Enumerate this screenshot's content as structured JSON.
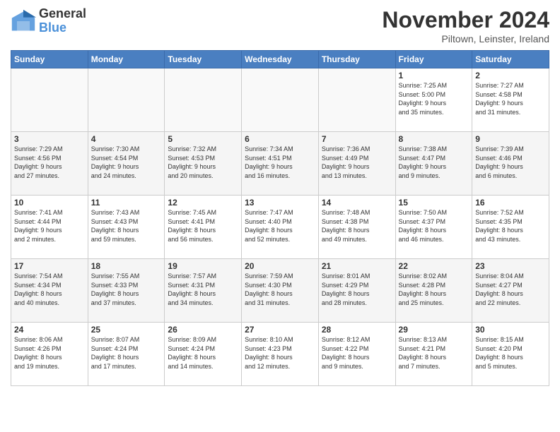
{
  "logo": {
    "general": "General",
    "blue": "Blue"
  },
  "title": "November 2024",
  "location": "Piltown, Leinster, Ireland",
  "days_of_week": [
    "Sunday",
    "Monday",
    "Tuesday",
    "Wednesday",
    "Thursday",
    "Friday",
    "Saturday"
  ],
  "weeks": [
    [
      {
        "day": "",
        "info": ""
      },
      {
        "day": "",
        "info": ""
      },
      {
        "day": "",
        "info": ""
      },
      {
        "day": "",
        "info": ""
      },
      {
        "day": "",
        "info": ""
      },
      {
        "day": "1",
        "info": "Sunrise: 7:25 AM\nSunset: 5:00 PM\nDaylight: 9 hours\nand 35 minutes."
      },
      {
        "day": "2",
        "info": "Sunrise: 7:27 AM\nSunset: 4:58 PM\nDaylight: 9 hours\nand 31 minutes."
      }
    ],
    [
      {
        "day": "3",
        "info": "Sunrise: 7:29 AM\nSunset: 4:56 PM\nDaylight: 9 hours\nand 27 minutes."
      },
      {
        "day": "4",
        "info": "Sunrise: 7:30 AM\nSunset: 4:54 PM\nDaylight: 9 hours\nand 24 minutes."
      },
      {
        "day": "5",
        "info": "Sunrise: 7:32 AM\nSunset: 4:53 PM\nDaylight: 9 hours\nand 20 minutes."
      },
      {
        "day": "6",
        "info": "Sunrise: 7:34 AM\nSunset: 4:51 PM\nDaylight: 9 hours\nand 16 minutes."
      },
      {
        "day": "7",
        "info": "Sunrise: 7:36 AM\nSunset: 4:49 PM\nDaylight: 9 hours\nand 13 minutes."
      },
      {
        "day": "8",
        "info": "Sunrise: 7:38 AM\nSunset: 4:47 PM\nDaylight: 9 hours\nand 9 minutes."
      },
      {
        "day": "9",
        "info": "Sunrise: 7:39 AM\nSunset: 4:46 PM\nDaylight: 9 hours\nand 6 minutes."
      }
    ],
    [
      {
        "day": "10",
        "info": "Sunrise: 7:41 AM\nSunset: 4:44 PM\nDaylight: 9 hours\nand 2 minutes."
      },
      {
        "day": "11",
        "info": "Sunrise: 7:43 AM\nSunset: 4:43 PM\nDaylight: 8 hours\nand 59 minutes."
      },
      {
        "day": "12",
        "info": "Sunrise: 7:45 AM\nSunset: 4:41 PM\nDaylight: 8 hours\nand 56 minutes."
      },
      {
        "day": "13",
        "info": "Sunrise: 7:47 AM\nSunset: 4:40 PM\nDaylight: 8 hours\nand 52 minutes."
      },
      {
        "day": "14",
        "info": "Sunrise: 7:48 AM\nSunset: 4:38 PM\nDaylight: 8 hours\nand 49 minutes."
      },
      {
        "day": "15",
        "info": "Sunrise: 7:50 AM\nSunset: 4:37 PM\nDaylight: 8 hours\nand 46 minutes."
      },
      {
        "day": "16",
        "info": "Sunrise: 7:52 AM\nSunset: 4:35 PM\nDaylight: 8 hours\nand 43 minutes."
      }
    ],
    [
      {
        "day": "17",
        "info": "Sunrise: 7:54 AM\nSunset: 4:34 PM\nDaylight: 8 hours\nand 40 minutes."
      },
      {
        "day": "18",
        "info": "Sunrise: 7:55 AM\nSunset: 4:33 PM\nDaylight: 8 hours\nand 37 minutes."
      },
      {
        "day": "19",
        "info": "Sunrise: 7:57 AM\nSunset: 4:31 PM\nDaylight: 8 hours\nand 34 minutes."
      },
      {
        "day": "20",
        "info": "Sunrise: 7:59 AM\nSunset: 4:30 PM\nDaylight: 8 hours\nand 31 minutes."
      },
      {
        "day": "21",
        "info": "Sunrise: 8:01 AM\nSunset: 4:29 PM\nDaylight: 8 hours\nand 28 minutes."
      },
      {
        "day": "22",
        "info": "Sunrise: 8:02 AM\nSunset: 4:28 PM\nDaylight: 8 hours\nand 25 minutes."
      },
      {
        "day": "23",
        "info": "Sunrise: 8:04 AM\nSunset: 4:27 PM\nDaylight: 8 hours\nand 22 minutes."
      }
    ],
    [
      {
        "day": "24",
        "info": "Sunrise: 8:06 AM\nSunset: 4:26 PM\nDaylight: 8 hours\nand 19 minutes."
      },
      {
        "day": "25",
        "info": "Sunrise: 8:07 AM\nSunset: 4:24 PM\nDaylight: 8 hours\nand 17 minutes."
      },
      {
        "day": "26",
        "info": "Sunrise: 8:09 AM\nSunset: 4:24 PM\nDaylight: 8 hours\nand 14 minutes."
      },
      {
        "day": "27",
        "info": "Sunrise: 8:10 AM\nSunset: 4:23 PM\nDaylight: 8 hours\nand 12 minutes."
      },
      {
        "day": "28",
        "info": "Sunrise: 8:12 AM\nSunset: 4:22 PM\nDaylight: 8 hours\nand 9 minutes."
      },
      {
        "day": "29",
        "info": "Sunrise: 8:13 AM\nSunset: 4:21 PM\nDaylight: 8 hours\nand 7 minutes."
      },
      {
        "day": "30",
        "info": "Sunrise: 8:15 AM\nSunset: 4:20 PM\nDaylight: 8 hours\nand 5 minutes."
      }
    ]
  ]
}
